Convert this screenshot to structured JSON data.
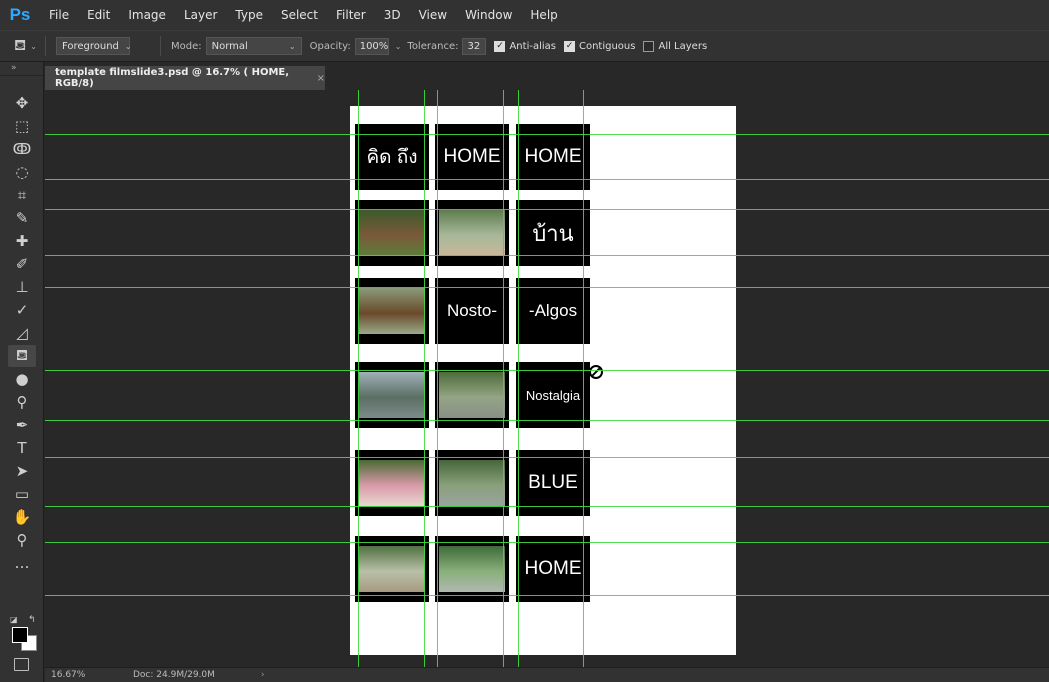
{
  "app": {
    "logo": "Ps",
    "menu": [
      "File",
      "Edit",
      "Image",
      "Layer",
      "Type",
      "Select",
      "Filter",
      "3D",
      "View",
      "Window",
      "Help"
    ]
  },
  "options": {
    "fill_source": "Foreground",
    "mode_label": "Mode:",
    "mode_value": "Normal",
    "opacity_label": "Opacity:",
    "opacity_value": "100%",
    "tolerance_label": "Tolerance:",
    "tolerance_value": "32",
    "anti_alias_label": "Anti-alias",
    "anti_alias_checked": true,
    "contiguous_label": "Contiguous",
    "contiguous_checked": true,
    "all_layers_label": "All Layers",
    "all_layers_checked": false
  },
  "tools": [
    {
      "name": "move-tool-icon",
      "glyph": "✥"
    },
    {
      "name": "marquee-tool-icon",
      "glyph": "⬚"
    },
    {
      "name": "lasso-tool-icon",
      "glyph": "ↂ"
    },
    {
      "name": "quick-select-tool-icon",
      "glyph": "◌"
    },
    {
      "name": "crop-tool-icon",
      "glyph": "⌗"
    },
    {
      "name": "eyedropper-tool-icon",
      "glyph": "✎"
    },
    {
      "name": "healing-brush-tool-icon",
      "glyph": "✚"
    },
    {
      "name": "brush-tool-icon",
      "glyph": "✐"
    },
    {
      "name": "clone-stamp-tool-icon",
      "glyph": "⊥"
    },
    {
      "name": "history-brush-tool-icon",
      "glyph": "✓"
    },
    {
      "name": "eraser-tool-icon",
      "glyph": "◿"
    },
    {
      "name": "paint-bucket-tool-icon",
      "glyph": "⛾"
    },
    {
      "name": "blur-tool-icon",
      "glyph": "●"
    },
    {
      "name": "dodge-tool-icon",
      "glyph": "⚲"
    },
    {
      "name": "pen-tool-icon",
      "glyph": "✒"
    },
    {
      "name": "type-tool-icon",
      "glyph": "T"
    },
    {
      "name": "path-select-tool-icon",
      "glyph": "➤"
    },
    {
      "name": "rectangle-tool-icon",
      "glyph": "▭"
    },
    {
      "name": "hand-tool-icon",
      "glyph": "✋"
    },
    {
      "name": "zoom-tool-icon",
      "glyph": "⚲"
    },
    {
      "name": "more-tools-icon",
      "glyph": "…"
    }
  ],
  "tools_collapse": "»",
  "document": {
    "tab_title": "template filmslide3.psd @ 16.7% ( HOME, RGB/8)",
    "tab_close": "×"
  },
  "slides": [
    {
      "kind": "text",
      "text": "คิด ถึง",
      "size": 19
    },
    {
      "kind": "text",
      "text": "HOME",
      "size": 19
    },
    {
      "kind": "text",
      "text": "HOME",
      "size": 19
    },
    {
      "kind": "photo",
      "desc": "gate-with-trees"
    },
    {
      "kind": "photo",
      "desc": "country-road"
    },
    {
      "kind": "text",
      "text": "บ้าน",
      "size": 22
    },
    {
      "kind": "photo",
      "desc": "wooden-house"
    },
    {
      "kind": "text",
      "text": "Nosto-",
      "size": 17
    },
    {
      "kind": "text",
      "text": "-Algos",
      "size": 17
    },
    {
      "kind": "photo",
      "desc": "lake-mountains"
    },
    {
      "kind": "photo",
      "desc": "road-through-trees"
    },
    {
      "kind": "text",
      "text": "Nostalgia",
      "size": 13
    },
    {
      "kind": "photo",
      "desc": "pink-flowers"
    },
    {
      "kind": "photo",
      "desc": "forest-road"
    },
    {
      "kind": "text",
      "text": "BLUE",
      "size": 19
    },
    {
      "kind": "photo",
      "desc": "tree-lined-road"
    },
    {
      "kind": "photo",
      "desc": "green-road"
    },
    {
      "kind": "text",
      "text": "HOME",
      "size": 19
    }
  ],
  "status": {
    "zoom": "16.67%",
    "doc_size": "Doc: 24.9M/29.0M",
    "arrow": "›"
  }
}
